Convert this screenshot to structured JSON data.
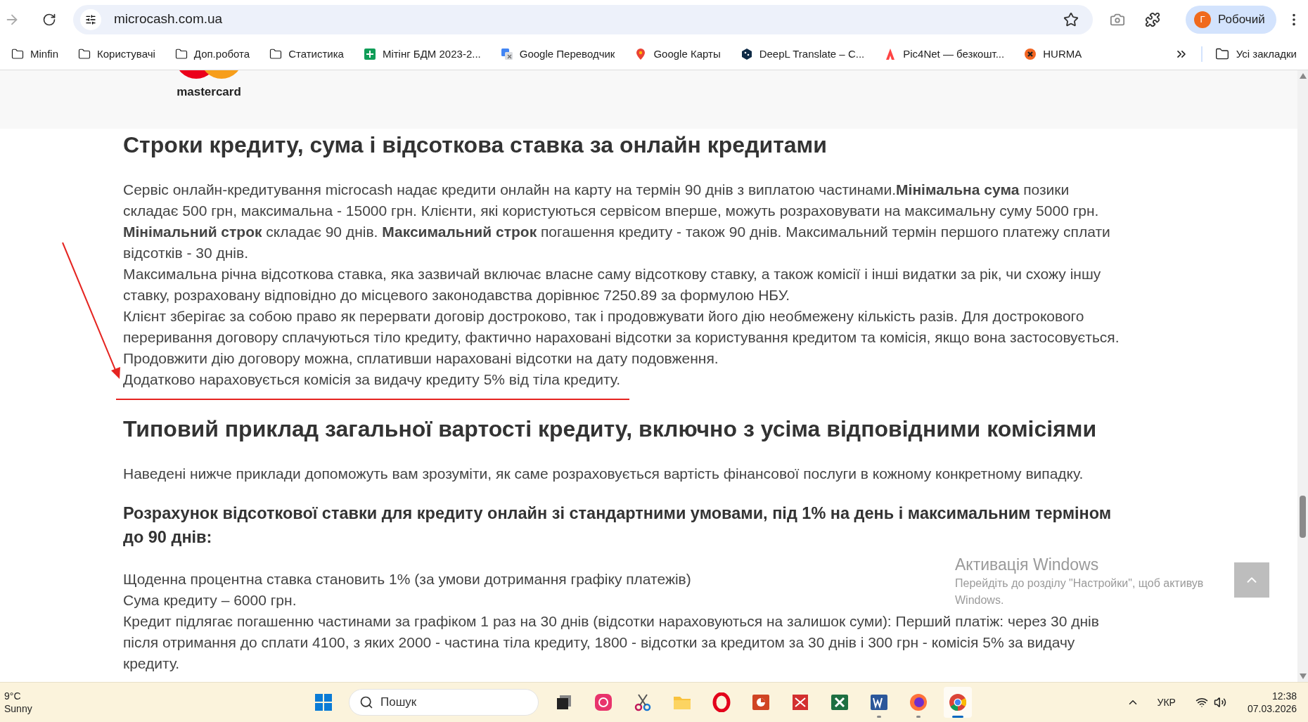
{
  "browser": {
    "url": "microcash.com.ua",
    "profile": {
      "initial": "Г",
      "name": "Робочий"
    },
    "bookmarks": [
      {
        "label": "Minfin",
        "kind": "folder"
      },
      {
        "label": "Користувачі",
        "kind": "folder"
      },
      {
        "label": "Доп.робота",
        "kind": "folder"
      },
      {
        "label": "Статистика",
        "kind": "folder"
      },
      {
        "label": "Мітінг БДМ 2023-2...",
        "kind": "sheet"
      },
      {
        "label": "Google Переводчик",
        "kind": "translate"
      },
      {
        "label": "Google Карты",
        "kind": "maps"
      },
      {
        "label": "DeepL Translate – C...",
        "kind": "deepl"
      },
      {
        "label": "Pic4Net — безкошт...",
        "kind": "pic4net"
      },
      {
        "label": "HURMA",
        "kind": "hurma"
      }
    ],
    "all_bookmarks": "Усі закладки"
  },
  "page": {
    "logo_strip": {
      "brand": "mastercard"
    },
    "blocks": [
      {
        "kind": "h2",
        "text": "Строки кредиту, сума і відсоткова ставка за онлайн кредитами"
      },
      {
        "kind": "p",
        "text": "Сервіс онлайн-кредитування microcash надає кредити онлайн на карту на термін 90 днів з виплатою частинами.**Мінімальна сума** позики складає 500 грн, максимальна - 15000 грн. Клієнти, які користуються сервісом вперше, можуть розраховувати на максимальну суму 5000 грн. **Мінімальний строк** складає 90 днів. **Максимальний строк** погашення кредиту - також 90 днів. Максимальний термін першого платежу сплати відсотків - 30 днів."
      },
      {
        "kind": "p",
        "text": "Максимальна річна відсоткова ставка, яка зазвичай включає власне саму відсоткову ставку, а також комісії і інші видатки за рік, чи схожу іншу ставку, розраховану відповідно до місцевого законодавства дорівнює 7250.89 за формулою НБУ."
      },
      {
        "kind": "p",
        "text": "Клієнт зберігає за собою право як перервати договір достроково, так і продовжувати його дію необмежену кількість разів. Для дострокового переривання договору сплачуються тіло кредиту, фактично нараховані відсотки за користування кредитом та комісія, якщо вона застосовується."
      },
      {
        "kind": "p",
        "text": "Продовжити дію договору можна, сплативши нараховані відсотки на дату подовження."
      },
      {
        "kind": "p",
        "text": "Додатково нараховується комісія за видачу кредиту 5% від тіла кредиту."
      },
      {
        "kind": "h2",
        "text": "Типовий приклад загальної вартості кредиту, включно з усіма відповідними комісіями"
      },
      {
        "kind": "p",
        "text": "Наведені нижче приклади допоможуть вам зрозуміти, як саме розраховується вартість фінансової послуги в кожному конкретному випадку."
      },
      {
        "kind": "h3",
        "text": "Розрахунок відсоткової ставки для кредиту онлайн зі стандартними умовами, під 1% на день і максимальним терміном до 90 днів:"
      },
      {
        "kind": "p",
        "text": "Щоденна процентна ставка становить 1% (за умови дотримання графіку платежів)"
      },
      {
        "kind": "p",
        "text": "Сума кредиту – 6000 грн."
      },
      {
        "kind": "p",
        "text": "Кредит підлягає погашенню частинами за графіком 1 раз на 30 днів (відсотки нараховуються на залишок суми): Перший платіж: через 30 днів після отримання до сплати 4100, з яких 2000 - частина тіла кредиту, 1800 - відсотки за кредитом за 30 днів і 300 грн - комісія 5% за видачу кредиту."
      }
    ]
  },
  "activation": {
    "title": "Активація Windows",
    "text": "Перейдіть до розділу \"Настройки\", щоб активув",
    "text_2": "Windows."
  },
  "taskbar": {
    "weather": {
      "temp": "9°C",
      "condition": "Sunny"
    },
    "search": {
      "placeholder": "Пошук"
    },
    "apps": [
      {
        "kind": "start",
        "running": false,
        "selected": false
      },
      {
        "kind": "taskview",
        "running": false,
        "selected": false
      },
      {
        "kind": "creative",
        "running": false,
        "selected": false
      },
      {
        "kind": "snip",
        "running": false,
        "selected": false
      },
      {
        "kind": "explorer",
        "running": false,
        "selected": false
      },
      {
        "kind": "opera",
        "running": false,
        "selected": false
      },
      {
        "kind": "powerpoint",
        "running": false,
        "selected": false
      },
      {
        "kind": "pdf",
        "running": false,
        "selected": false
      },
      {
        "kind": "excel",
        "running": false,
        "selected": false
      },
      {
        "kind": "word",
        "running": true,
        "selected": false
      },
      {
        "kind": "firefox",
        "running": true,
        "selected": false
      },
      {
        "kind": "chrome",
        "running": true,
        "selected": true
      }
    ],
    "language": "УКР",
    "time": "12:38",
    "date": "07.03.2026"
  }
}
